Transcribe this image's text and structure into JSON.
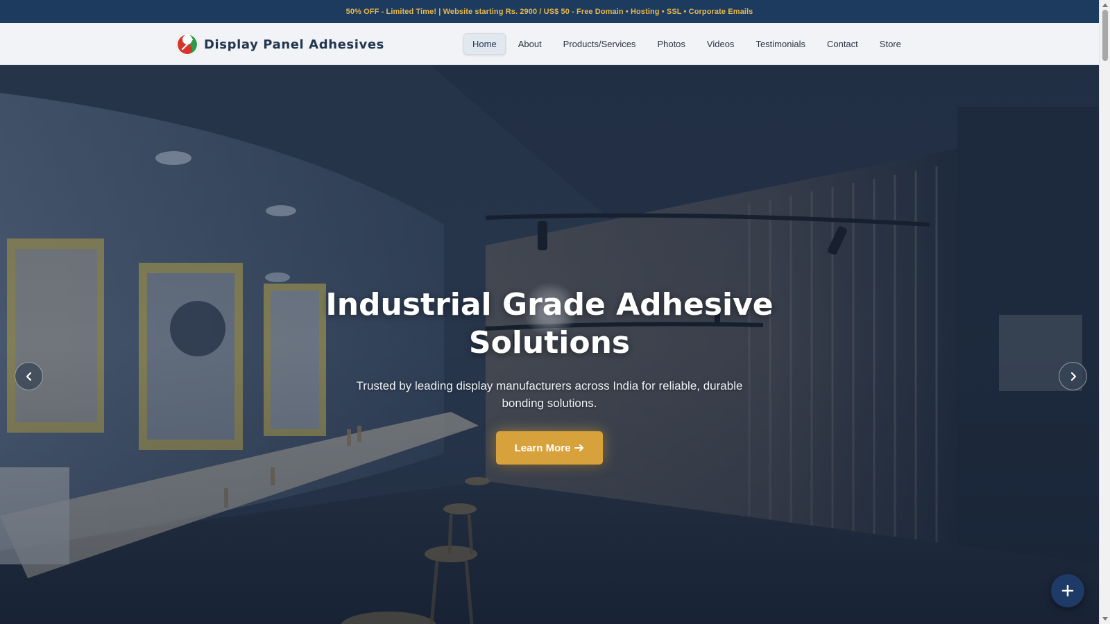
{
  "promo": {
    "text": "50% OFF - Limited Time! | Website starting Rs. 2900 / US$ 50 - Free Domain • Hosting • SSL • Corporate Emails"
  },
  "brand": {
    "name": "Display Panel Adhesives",
    "logo_icon": "yin-yang-logo-icon"
  },
  "nav": {
    "items": [
      {
        "label": "Home",
        "active": true
      },
      {
        "label": "About",
        "active": false
      },
      {
        "label": "Products/Services",
        "active": false
      },
      {
        "label": "Photos",
        "active": false
      },
      {
        "label": "Videos",
        "active": false
      },
      {
        "label": "Testimonials",
        "active": false
      },
      {
        "label": "Contact",
        "active": false
      },
      {
        "label": "Store",
        "active": false
      }
    ]
  },
  "hero": {
    "title": "Industrial Grade Adhesive Solutions",
    "subtitle": "Trusted by leading display manufacturers across India for reliable, durable bonding solutions.",
    "cta_label": "Learn More",
    "cta_icon": "arrow-right-icon",
    "prev_icon": "chevron-left-icon",
    "next_icon": "chevron-right-icon"
  },
  "fab": {
    "icon": "plus-icon"
  },
  "colors": {
    "promo_bg": "#1c3b5f",
    "promo_text": "#e8b84a",
    "header_bg": "#f1f3f6",
    "brand_text": "#22364f",
    "cta_bg": "#d7a23c",
    "fab_bg": "#1e3a66"
  }
}
